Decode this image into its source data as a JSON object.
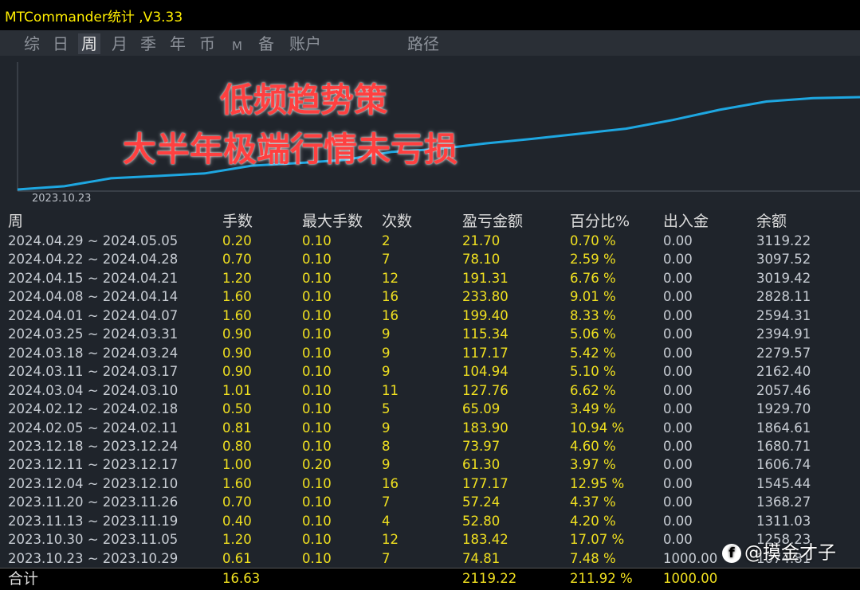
{
  "app": {
    "title": "MTCommander统计 ,V3.33"
  },
  "tabs": [
    {
      "label": "综",
      "active": false
    },
    {
      "label": "日",
      "active": false
    },
    {
      "label": "周",
      "active": true
    },
    {
      "label": "月",
      "active": false
    },
    {
      "label": "季",
      "active": false
    },
    {
      "label": "年",
      "active": false
    },
    {
      "label": "币",
      "active": false
    },
    {
      "label": "M",
      "active": false
    },
    {
      "label": "备",
      "active": false
    },
    {
      "label": "账户",
      "active": false
    },
    {
      "label": "路径",
      "active": false
    }
  ],
  "chart": {
    "overlay_line1": "低频趋势策",
    "overlay_line2": "大半年极端行情未亏损",
    "start_date": "2023.10.23",
    "line_color": "#1ea7e1"
  },
  "table": {
    "headers": [
      "周",
      "手数",
      "最大手数",
      "次数",
      "盈亏金额",
      "百分比%",
      "出入金",
      "余额"
    ],
    "rows": [
      [
        "2024.04.29 ~ 2024.05.05",
        "0.20",
        "0.10",
        "2",
        "21.70",
        "0.70 %",
        "0.00",
        "3119.22"
      ],
      [
        "2024.04.22 ~ 2024.04.28",
        "0.70",
        "0.10",
        "7",
        "78.10",
        "2.59 %",
        "0.00",
        "3097.52"
      ],
      [
        "2024.04.15 ~ 2024.04.21",
        "1.20",
        "0.10",
        "12",
        "191.31",
        "6.76 %",
        "0.00",
        "3019.42"
      ],
      [
        "2024.04.08 ~ 2024.04.14",
        "1.60",
        "0.10",
        "16",
        "233.80",
        "9.01 %",
        "0.00",
        "2828.11"
      ],
      [
        "2024.04.01 ~ 2024.04.07",
        "1.60",
        "0.10",
        "16",
        "199.40",
        "8.33 %",
        "0.00",
        "2594.31"
      ],
      [
        "2024.03.25 ~ 2024.03.31",
        "0.90",
        "0.10",
        "9",
        "115.34",
        "5.06 %",
        "0.00",
        "2394.91"
      ],
      [
        "2024.03.18 ~ 2024.03.24",
        "0.90",
        "0.10",
        "9",
        "117.17",
        "5.42 %",
        "0.00",
        "2279.57"
      ],
      [
        "2024.03.11 ~ 2024.03.17",
        "0.90",
        "0.10",
        "9",
        "104.94",
        "5.10 %",
        "0.00",
        "2162.40"
      ],
      [
        "2024.03.04 ~ 2024.03.10",
        "1.01",
        "0.10",
        "11",
        "127.76",
        "6.62 %",
        "0.00",
        "2057.46"
      ],
      [
        "2024.02.12 ~ 2024.02.18",
        "0.50",
        "0.10",
        "5",
        "65.09",
        "3.49 %",
        "0.00",
        "1929.70"
      ],
      [
        "2024.02.05 ~ 2024.02.11",
        "0.81",
        "0.10",
        "9",
        "183.90",
        "10.94 %",
        "0.00",
        "1864.61"
      ],
      [
        "2023.12.18 ~ 2023.12.24",
        "0.80",
        "0.10",
        "8",
        "73.97",
        "4.60 %",
        "0.00",
        "1680.71"
      ],
      [
        "2023.12.11 ~ 2023.12.17",
        "1.00",
        "0.20",
        "9",
        "61.30",
        "3.97 %",
        "0.00",
        "1606.74"
      ],
      [
        "2023.12.04 ~ 2023.12.10",
        "1.60",
        "0.10",
        "16",
        "177.17",
        "12.95 %",
        "0.00",
        "1545.44"
      ],
      [
        "2023.11.20 ~ 2023.11.26",
        "0.70",
        "0.10",
        "7",
        "57.24",
        "4.37 %",
        "0.00",
        "1368.27"
      ],
      [
        "2023.11.13 ~ 2023.11.19",
        "0.40",
        "0.10",
        "4",
        "52.80",
        "4.20 %",
        "0.00",
        "1311.03"
      ],
      [
        "2023.10.30 ~ 2023.11.05",
        "1.20",
        "0.10",
        "12",
        "183.42",
        "17.07 %",
        "0.00",
        "1258.23"
      ],
      [
        "2023.10.23 ~ 2023.10.29",
        "0.61",
        "0.10",
        "7",
        "74.81",
        "7.48 %",
        "1000.00",
        "1074.81"
      ]
    ],
    "total": {
      "label": "合计",
      "lots": "16.63",
      "profit": "2119.22",
      "percent": "211.92 %",
      "deposit": "1000.00"
    }
  },
  "watermark": {
    "logo": "f",
    "text": "@摸金才子"
  }
}
